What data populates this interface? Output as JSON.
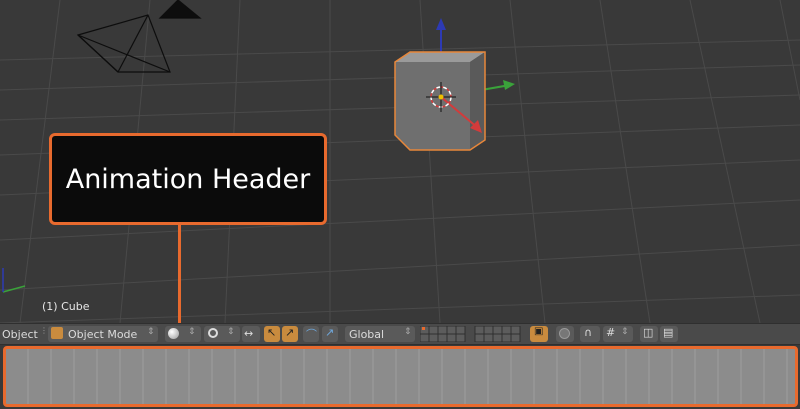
{
  "callout": {
    "text": "Animation Header"
  },
  "viewport": {
    "object_label": "(1) Cube"
  },
  "header": {
    "object_menu": "Object",
    "mode_label": "Object Mode",
    "orientation_label": "Global"
  },
  "colors": {
    "accent": "#e86a2e",
    "viewport_bg": "#393939",
    "header_bg": "#4a4a4a",
    "timeline_bg": "#8c8c8c",
    "axis_x": "#d33b3b",
    "axis_y": "#3aa23a",
    "axis_z": "#2d3ab4"
  },
  "icons": [
    "camera-object-icon",
    "lamp-object-icon",
    "cube-object-icon",
    "3d-cursor-icon",
    "cube-mode-icon",
    "shading-sphere-icon",
    "pivot-icon",
    "manipulator-icon",
    "translate-icon",
    "rotate-icon",
    "scale-icon",
    "layers-grid-icon",
    "render-icon",
    "lock-icon",
    "magnet-icon",
    "snap-icon",
    "opengl-render-icon",
    "clapboard-icon"
  ]
}
